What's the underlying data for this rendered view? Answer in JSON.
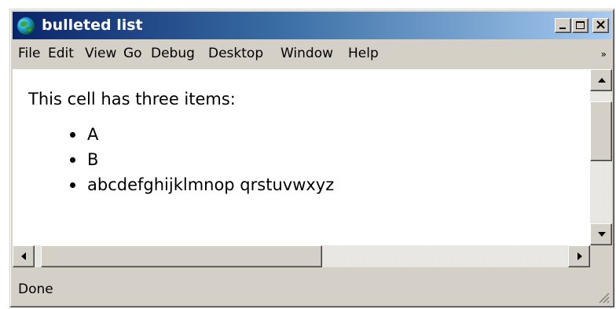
{
  "window": {
    "title": "bulleted list",
    "icon": "globe-icon",
    "buttons": {
      "minimize": "minimize-icon",
      "maximize": "maximize-icon",
      "close": "×"
    }
  },
  "menubar": {
    "items": [
      "File",
      "Edit",
      "View",
      "Go",
      "Debug",
      "Desktop",
      "Window",
      "Help"
    ],
    "overflow_glyph": "»"
  },
  "content": {
    "intro": "This cell has three items:",
    "list": [
      "A",
      "B",
      "abcdefghijklmnop qrstuvwxyz"
    ]
  },
  "status": {
    "text": "Done"
  },
  "colors": {
    "titlebar_start": "#0a246a",
    "titlebar_end": "#a6caf0",
    "chrome": "#d4d0c8"
  }
}
